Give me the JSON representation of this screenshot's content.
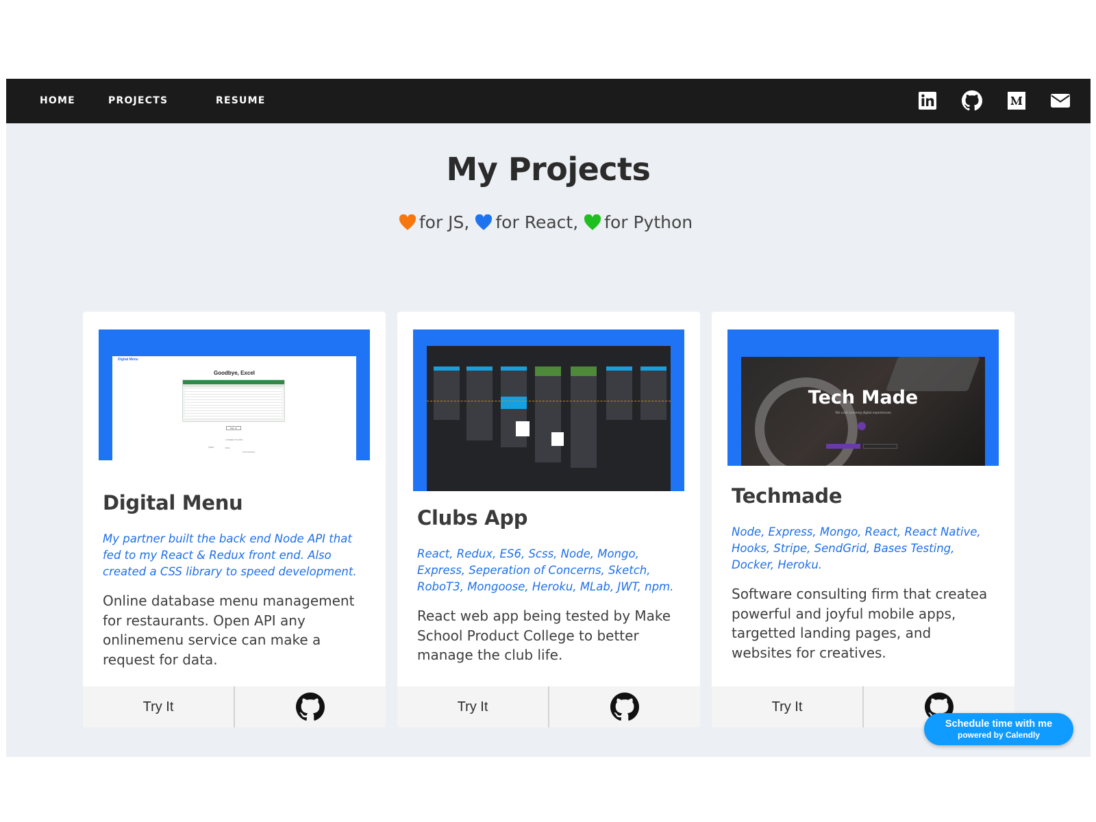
{
  "nav": {
    "links": [
      {
        "label": "HOME"
      },
      {
        "label": "PROJECTS"
      },
      {
        "label": "RESUME"
      }
    ],
    "social": [
      "linkedin-icon",
      "github-icon",
      "medium-icon",
      "mail-icon"
    ]
  },
  "header": {
    "title": "My Projects",
    "legend": [
      {
        "color": "#f7760d",
        "text": "for JS,"
      },
      {
        "color": "#1e73f0",
        "text": "for React,"
      },
      {
        "color": "#1fbf1f",
        "text": "for Python"
      }
    ]
  },
  "projects": [
    {
      "title": "Digital Menu",
      "tech": "My partner built the back end Node API that fed to my React & Redux front end. Also created a CSS library to speed development.",
      "description": "Online database menu management for restaurants. Open API any onlinemenu service can make a request for data.",
      "try_label": "Try It",
      "preview": {
        "brand": "Digital Menu",
        "headline": "Goodbye, Excel",
        "button": "Sign up",
        "footer": "CONNECTS WITH",
        "partners": [
          "Uber",
          "BITE",
          "POSTMATES"
        ]
      }
    },
    {
      "title": "Clubs App",
      "tech": "React, Redux, ES6, Scss, Node, Mongo, Express, Seperation of Concerns, Sketch, RoboT3, Mongoose, Heroku, MLab, JWT, npm.",
      "description": "React web app being tested by Make School Product College to better manage the club life.",
      "try_label": "Try It"
    },
    {
      "title": "Techmade",
      "tech": "Node, Express, Mongo, React, React Native, Hooks, Stripe, SendGrid, Bases Testing, Docker, Heroku.",
      "description": "Software consulting firm that createa powerful and joyful mobile apps, targetted landing pages, and websites for creatives.",
      "try_label": "Try It",
      "preview": {
        "headline": "Tech Made",
        "tagline": "We craft stunning digital experiences"
      }
    }
  ],
  "calendly": {
    "main": "Schedule time with me",
    "sub": "powered by Calendly"
  },
  "colors": {
    "nav_bg": "#1b1b1b",
    "page_bg": "#eceff3",
    "accent_blue": "#1e74f5",
    "tech_text": "#1e6fe8",
    "calendly": "#0f9bff"
  }
}
